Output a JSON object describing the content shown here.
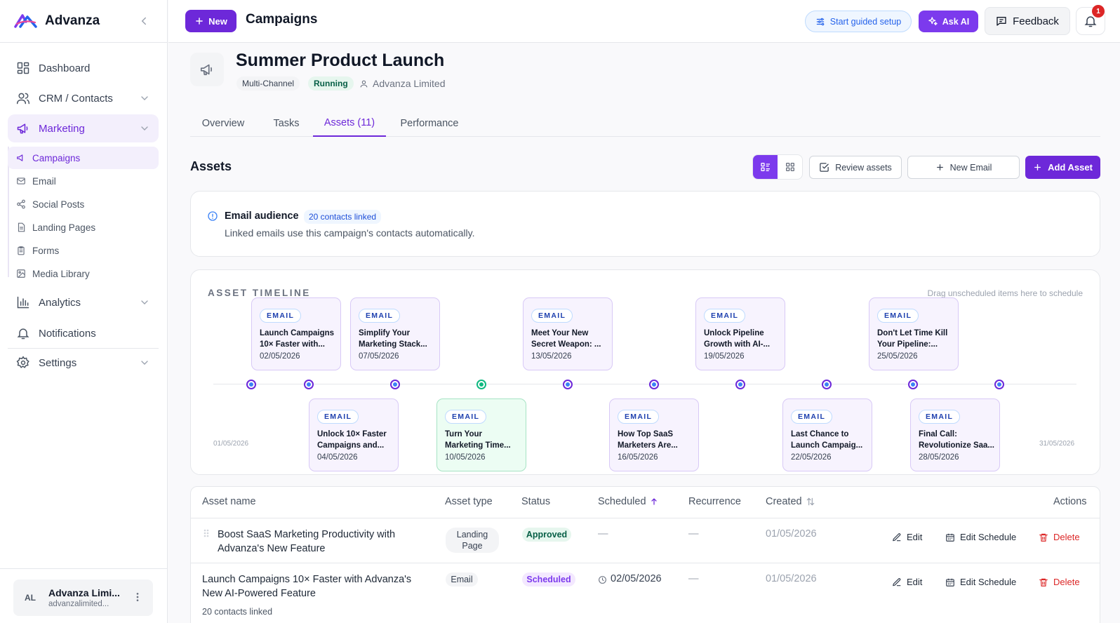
{
  "app": {
    "name": "Advanza"
  },
  "sidebar": {
    "items": [
      {
        "label": "Dashboard"
      },
      {
        "label": "CRM / Contacts"
      },
      {
        "label": "Marketing"
      },
      {
        "label": "Analytics"
      },
      {
        "label": "Notifications"
      },
      {
        "label": "Settings"
      }
    ],
    "marketing_sub": [
      {
        "label": "Campaigns"
      },
      {
        "label": "Email"
      },
      {
        "label": "Social Posts"
      },
      {
        "label": "Landing Pages"
      },
      {
        "label": "Forms"
      },
      {
        "label": "Media Library"
      }
    ],
    "user": {
      "initials": "AL",
      "name": "Advanza Limi...",
      "email": "advanzalimited..."
    }
  },
  "header": {
    "new_label": "New",
    "title": "Campaigns",
    "guided_label": "Start guided setup",
    "ai_label": "Ask AI",
    "feedback_label": "Feedback",
    "notification_count": "1"
  },
  "campaign": {
    "title": "Summer Product Launch",
    "channel": "Multi-Channel",
    "status": "Running",
    "owner": "Advanza Limited"
  },
  "tabs": [
    {
      "label": "Overview"
    },
    {
      "label": "Tasks"
    },
    {
      "label": "Assets (11)"
    },
    {
      "label": "Performance"
    }
  ],
  "assets": {
    "heading": "Assets",
    "review_label": "Review assets",
    "new_email_label": "New Email",
    "add_label": "Add Asset"
  },
  "audience": {
    "title": "Email audience",
    "chip": "20 contacts linked",
    "description": "Linked emails use this campaign's contacts automatically."
  },
  "timeline": {
    "heading": "ASSET TIMELINE",
    "hint": "Drag unscheduled items here to schedule",
    "start_label": "01/05/2026",
    "end_label": "31/05/2026",
    "type_label": "EMAIL",
    "top": [
      {
        "title": "Launch Campaigns 10× Faster with...",
        "date": "02/05/2026"
      },
      {
        "title": "Simplify Your Marketing Stack...",
        "date": "07/05/2026"
      },
      {
        "title": "Meet Your New Secret Weapon: ...",
        "date": "13/05/2026"
      },
      {
        "title": "Unlock Pipeline Growth with AI-...",
        "date": "19/05/2026"
      },
      {
        "title": "Don't Let Time Kill Your Pipeline:...",
        "date": "25/05/2026"
      }
    ],
    "bottom": [
      {
        "title": "Unlock 10× Faster Campaigns and...",
        "date": "04/05/2026"
      },
      {
        "title": "Turn Your Marketing Time...",
        "date": "10/05/2026"
      },
      {
        "title": "How Top SaaS Marketers Are...",
        "date": "16/05/2026"
      },
      {
        "title": "Last Chance to Launch Campaig...",
        "date": "22/05/2026"
      },
      {
        "title": "Final Call: Revolutionize Saa...",
        "date": "28/05/2026"
      }
    ]
  },
  "table": {
    "headers": {
      "name": "Asset name",
      "type": "Asset type",
      "status": "Status",
      "scheduled": "Scheduled",
      "recurrence": "Recurrence",
      "created": "Created",
      "actions": "Actions"
    },
    "edit_label": "Edit",
    "edit_schedule_label": "Edit Schedule",
    "delete_label": "Delete",
    "rows": [
      {
        "name": "Boost SaaS Marketing Productivity with Advanza's New Feature",
        "type": "Landing Page",
        "status": "Approved",
        "scheduled": "—",
        "recurrence": "—",
        "created": "01/05/2026"
      },
      {
        "name": "Launch Campaigns 10× Faster with Advanza's New AI-Powered Feature",
        "type": "Email",
        "status": "Scheduled",
        "scheduled": "02/05/2026",
        "recurrence": "—",
        "created": "01/05/2026",
        "sub": "20 contacts linked"
      }
    ]
  }
}
